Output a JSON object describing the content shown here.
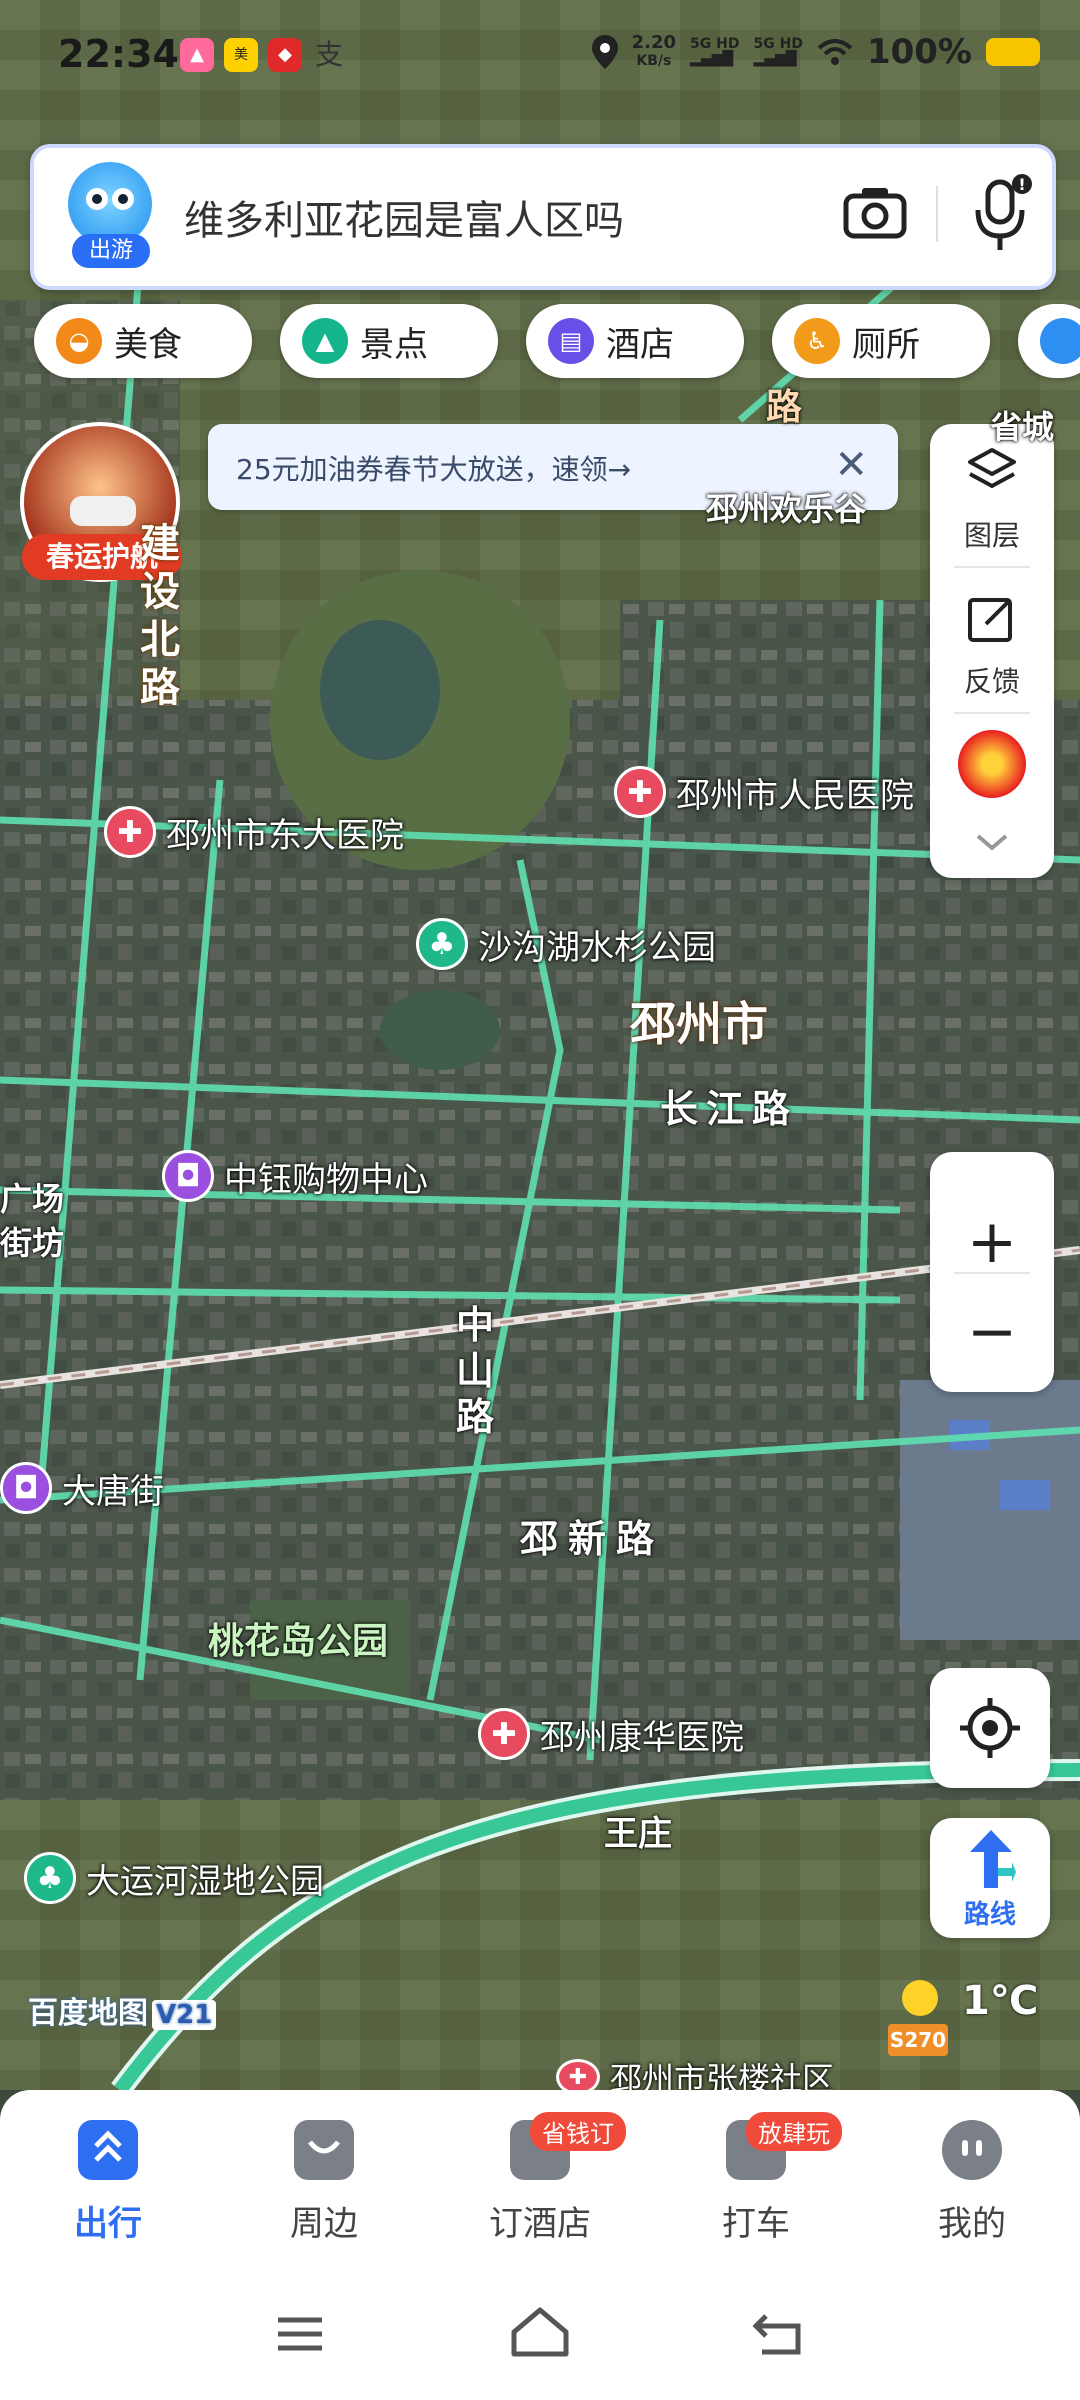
{
  "status_bar": {
    "time": "22:34",
    "app_badges": [
      "meituan-icon",
      "security-icon",
      "alipay-icon"
    ],
    "data_rate_value": "2.20",
    "data_rate_unit": "KB/s",
    "signal_1": "5G HD",
    "signal_2": "5G HD",
    "battery": "100%"
  },
  "search": {
    "badge": "出游",
    "query": "维多利亚花园是富人区吗"
  },
  "categories": [
    {
      "label": "美食",
      "icon": "food-icon",
      "color": "#f28a1a"
    },
    {
      "label": "景点",
      "icon": "scenic-icon",
      "color": "#14b58d"
    },
    {
      "label": "酒店",
      "icon": "hotel-icon",
      "color": "#6a4ee8"
    },
    {
      "label": "厕所",
      "icon": "toilet-icon",
      "color": "#f29a1a"
    }
  ],
  "banner": {
    "text": "25元加油券春节大放送，速领→"
  },
  "promo": {
    "label": "春运护航"
  },
  "side_panel": {
    "layers": "图层",
    "feedback": "反馈"
  },
  "route_button": {
    "label": "路线"
  },
  "map_labels": {
    "roads": {
      "jianshe_north": "建设北路",
      "changjiang": "长江路",
      "zhongshan": "中山路",
      "pixin": "邳新路",
      "top_road": "路",
      "province_city": "省城",
      "guangchang": "广场",
      "jiefang": "街坊"
    },
    "city": "邳州市",
    "places": {
      "huanle": "邳州欢乐谷",
      "wangzhuang": "王庄"
    },
    "pois": [
      {
        "name": "邳州市东大医院",
        "type": "hospital"
      },
      {
        "name": "邳州市人民医院",
        "type": "hospital"
      },
      {
        "name": "沙沟湖水杉公园",
        "type": "park"
      },
      {
        "name": "中钰购物中心",
        "type": "shopping"
      },
      {
        "name": "大唐街",
        "type": "shopping"
      },
      {
        "name": "桃花岛公园",
        "type": "park_text"
      },
      {
        "name": "邳州康华医院",
        "type": "hospital"
      },
      {
        "name": "大运河湿地公园",
        "type": "park"
      },
      {
        "name": "邳州市张楼社区",
        "type": "hospital"
      }
    ],
    "logo": "百度地图",
    "logo_version": "V21",
    "weather": "1℃",
    "highway": "S270"
  },
  "tabs": [
    {
      "label": "出行",
      "icon": "travel-icon",
      "active": true,
      "badge": ""
    },
    {
      "label": "周边",
      "icon": "nearby-icon",
      "active": false,
      "badge": ""
    },
    {
      "label": "订酒店",
      "icon": "hotel-booking-icon",
      "active": false,
      "badge": "省钱订"
    },
    {
      "label": "打车",
      "icon": "taxi-icon",
      "active": false,
      "badge": "放肆玩"
    },
    {
      "label": "我的",
      "icon": "profile-icon",
      "active": false,
      "badge": ""
    }
  ],
  "colors": {
    "accent": "#2e6ff2",
    "road_green": "#5fe0b0",
    "hospital": "#e84a5f",
    "park": "#1eb88a",
    "shopping": "#9b4fe0"
  }
}
